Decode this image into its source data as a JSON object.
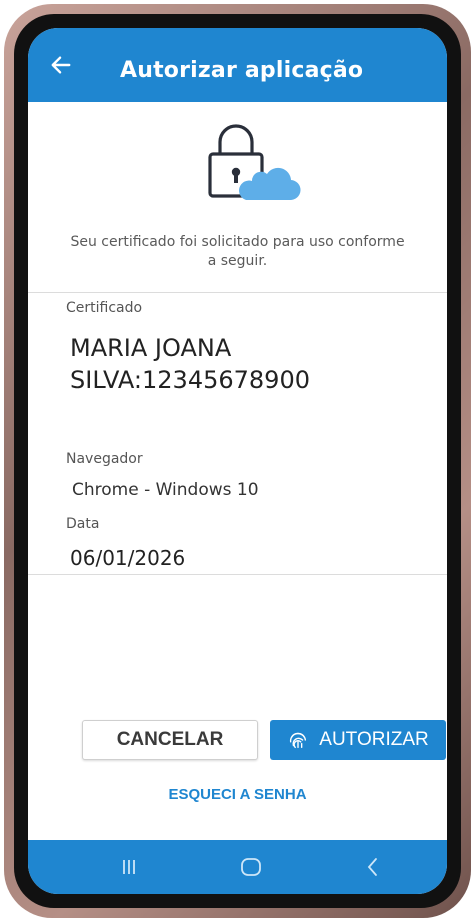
{
  "appbar": {
    "title": "Autorizar aplicação",
    "back_icon": "arrow-left-icon"
  },
  "header": {
    "illustration": "lock-cloud-icon",
    "intro_text": "Seu certificado foi solicitado para uso conforme a seguir."
  },
  "details": {
    "certificate_label": "Certificado",
    "certificate_line1": "MARIA JOANA",
    "certificate_line2": "SILVA:12345678900",
    "browser_label": "Navegador",
    "browser_value": "Chrome - Windows 10",
    "date_label": "Data",
    "date_value": "06/01/2026"
  },
  "actions": {
    "cancel_label": "CANCELAR",
    "authorize_label": "AUTORIZAR",
    "authorize_icon": "fingerprint-icon",
    "forgot_label": "ESQUECI A SENHA"
  },
  "system_nav": {
    "recents_icon": "recents-icon",
    "home_icon": "home-icon",
    "back_icon": "back-icon"
  },
  "colors": {
    "primary": "#1f86d0",
    "text_dark": "#222222",
    "text_muted": "#5a5a5a"
  }
}
